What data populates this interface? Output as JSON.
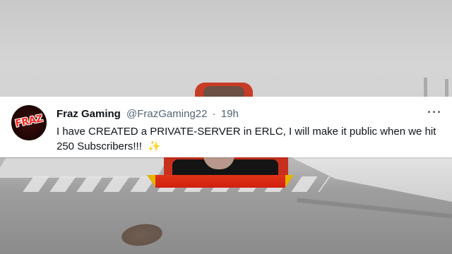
{
  "tweet": {
    "display_name": "Fraz Gaming",
    "handle": "@FrazGaming22",
    "separator": "·",
    "time": "19h",
    "more": "···",
    "text": "I have CREATED a PRIVATE-SERVER in ERLC, I will make it public when we hit 250 Subscribers!!!",
    "emoji": "✨",
    "avatar_text": "FRAZ"
  },
  "colors": {
    "name": "#0f1419",
    "secondary": "#536471",
    "avatar_accent": "#f22a22",
    "frame_red": "#c8301e"
  },
  "icons": {
    "more": "more-options-icon",
    "sparkles": "sparkles-emoji"
  }
}
